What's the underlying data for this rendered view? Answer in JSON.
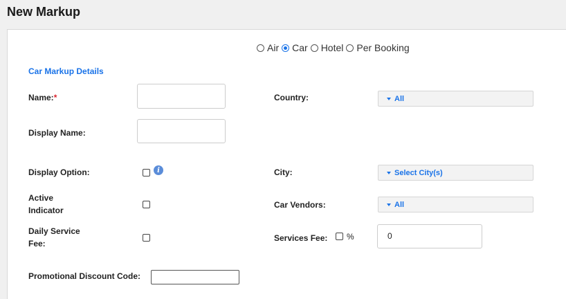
{
  "page": {
    "title": "New Markup"
  },
  "type_selector": {
    "options": [
      {
        "label": "Air",
        "checked": false
      },
      {
        "label": "Car",
        "checked": true
      },
      {
        "label": "Hotel",
        "checked": false
      },
      {
        "label": "Per Booking",
        "checked": false
      }
    ]
  },
  "section": {
    "title": "Car Markup Details"
  },
  "form": {
    "name": {
      "label": "Name:",
      "required_mark": "*",
      "value": ""
    },
    "display_name": {
      "label": "Display Name:",
      "value": ""
    },
    "display_option": {
      "label": "Display Option:",
      "checked": false,
      "info_glyph": "i"
    },
    "active_indicator": {
      "label_line1": "Active",
      "label_line2": "Indicator",
      "checked": false
    },
    "daily_service_fee": {
      "label_line1": "Daily Service",
      "label_line2": "Fee:",
      "checked": false
    },
    "promo_code": {
      "label": "Promotional Discount Code:",
      "value": ""
    },
    "country": {
      "label": "Country:",
      "selected": "All"
    },
    "city": {
      "label": "City:",
      "selected": "Select City(s)"
    },
    "car_vendors": {
      "label": "Car Vendors:",
      "selected": "All"
    },
    "services_fee": {
      "label": "Services Fee:",
      "percent_label": "%",
      "percent_checked": false,
      "value": "0"
    }
  },
  "colors": {
    "accent": "#1a73e8",
    "required": "#d9232d"
  }
}
